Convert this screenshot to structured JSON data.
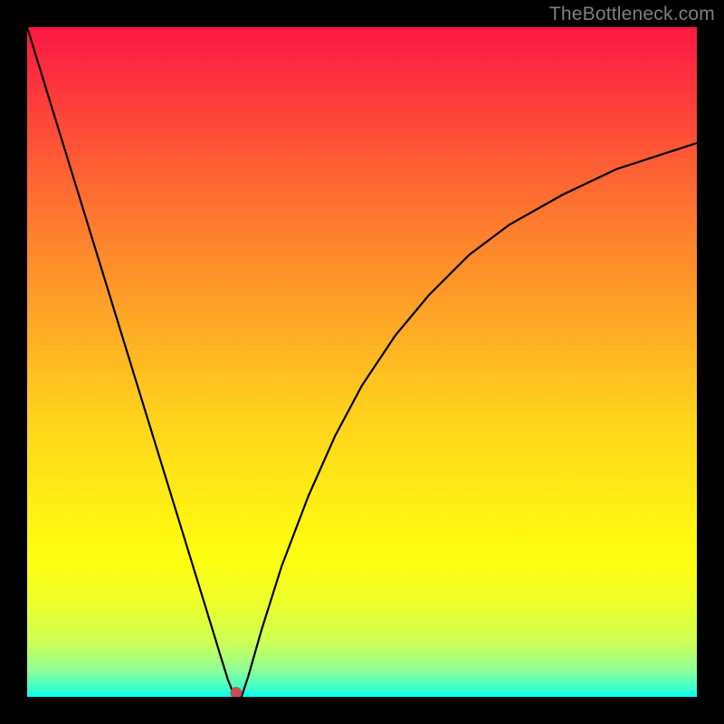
{
  "attribution": "TheBottleneck.com",
  "chart_data": {
    "type": "line",
    "title": "",
    "xlabel": "",
    "ylabel": "",
    "xlim": [
      0,
      100
    ],
    "ylim": [
      0,
      100
    ],
    "x": [
      0,
      2,
      4,
      6,
      8,
      10,
      12,
      14,
      16,
      18,
      20,
      22,
      24,
      26,
      28,
      29,
      30,
      31,
      32,
      33,
      35,
      38,
      42,
      46,
      50,
      55,
      60,
      66,
      72,
      80,
      88,
      100
    ],
    "values": [
      100,
      93.5,
      87,
      80.5,
      74,
      67.5,
      61,
      54.5,
      48,
      41.5,
      35,
      28.5,
      22,
      15.5,
      9,
      5.7,
      2.5,
      0,
      0,
      3,
      10,
      19.5,
      30,
      39,
      46.5,
      54,
      60,
      66,
      70.5,
      75,
      78.8,
      82.7
    ],
    "marker": {
      "x": 31.2,
      "y": 0.6,
      "color": "#c44e52",
      "radius_px": 6
    },
    "gradient_stops": [
      {
        "pos": 0.0,
        "color": "#fc1743"
      },
      {
        "pos": 0.14,
        "color": "#fd4739"
      },
      {
        "pos": 0.33,
        "color": "#fe872c"
      },
      {
        "pos": 0.53,
        "color": "#ffc31f"
      },
      {
        "pos": 0.76,
        "color": "#fff810"
      },
      {
        "pos": 0.92,
        "color": "#ccff55"
      },
      {
        "pos": 1.0,
        "color": "#01fff5"
      }
    ],
    "notch": {
      "x_start": 29,
      "x_end": 33
    }
  }
}
